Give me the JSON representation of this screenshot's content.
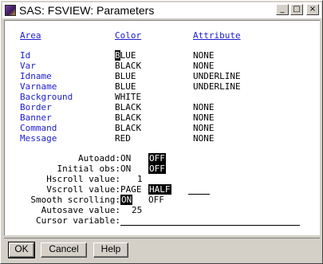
{
  "window": {
    "title": "SAS: FSVIEW: Parameters",
    "minimize": "_",
    "maximize": "□",
    "close": "×"
  },
  "headers": {
    "area": "Area",
    "color": "Color",
    "attribute": "Attribute"
  },
  "rows": [
    {
      "area": "Id",
      "color_first": "B",
      "color_rest": "LUE",
      "attribute": "NONE"
    },
    {
      "area": "Var",
      "color": "BLACK",
      "attribute": "NONE"
    },
    {
      "area": "Idname",
      "color": "BLUE",
      "attribute": "UNDERLINE"
    },
    {
      "area": "Varname",
      "color": "BLUE",
      "attribute": "UNDERLINE"
    },
    {
      "area": "Background",
      "color": "WHITE",
      "attribute": ""
    },
    {
      "area": "Border",
      "color": "BLACK",
      "attribute": "NONE"
    },
    {
      "area": "Banner",
      "color": "BLACK",
      "attribute": "NONE"
    },
    {
      "area": "Command",
      "color": "BLACK",
      "attribute": "NONE"
    },
    {
      "area": "Message",
      "color": "RED",
      "attribute": "NONE"
    }
  ],
  "options": {
    "autoadd": {
      "label": "Autoadd:",
      "on": "ON",
      "off": "OFF",
      "selected": "OFF"
    },
    "initial_obs": {
      "label": "Initial obs:",
      "on": "ON",
      "off": "OFF",
      "selected": "OFF"
    },
    "hscroll": {
      "label": "Hscroll value:",
      "value": "1"
    },
    "vscroll": {
      "label": "Vscroll value:",
      "page": "PAGE",
      "half": "HALF",
      "selected": "HALF"
    },
    "smooth_scrolling": {
      "label": "Smooth scrolling:",
      "on": "ON",
      "off": "OFF",
      "selected": "ON"
    },
    "autosave": {
      "label": "Autosave value:",
      "value": "25"
    },
    "cursor_variable": {
      "label": "Cursor variable:",
      "value": ""
    }
  },
  "buttons": {
    "ok": "OK",
    "cancel": "Cancel",
    "help": "Help"
  }
}
